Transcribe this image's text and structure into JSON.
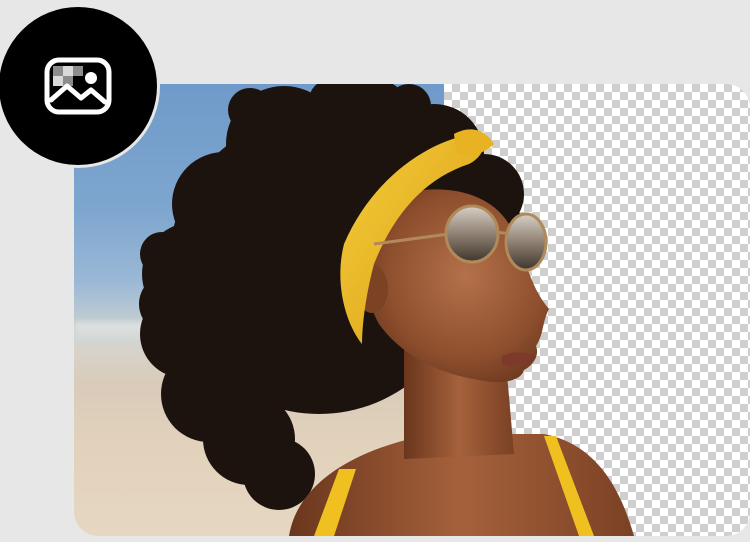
{
  "badge": {
    "icon": "image-icon"
  },
  "comparison": {
    "left_side": "original-photo",
    "right_side": "transparent-background",
    "checker_color": "#cfcfcf",
    "accent_yellow": "#f0c020"
  }
}
